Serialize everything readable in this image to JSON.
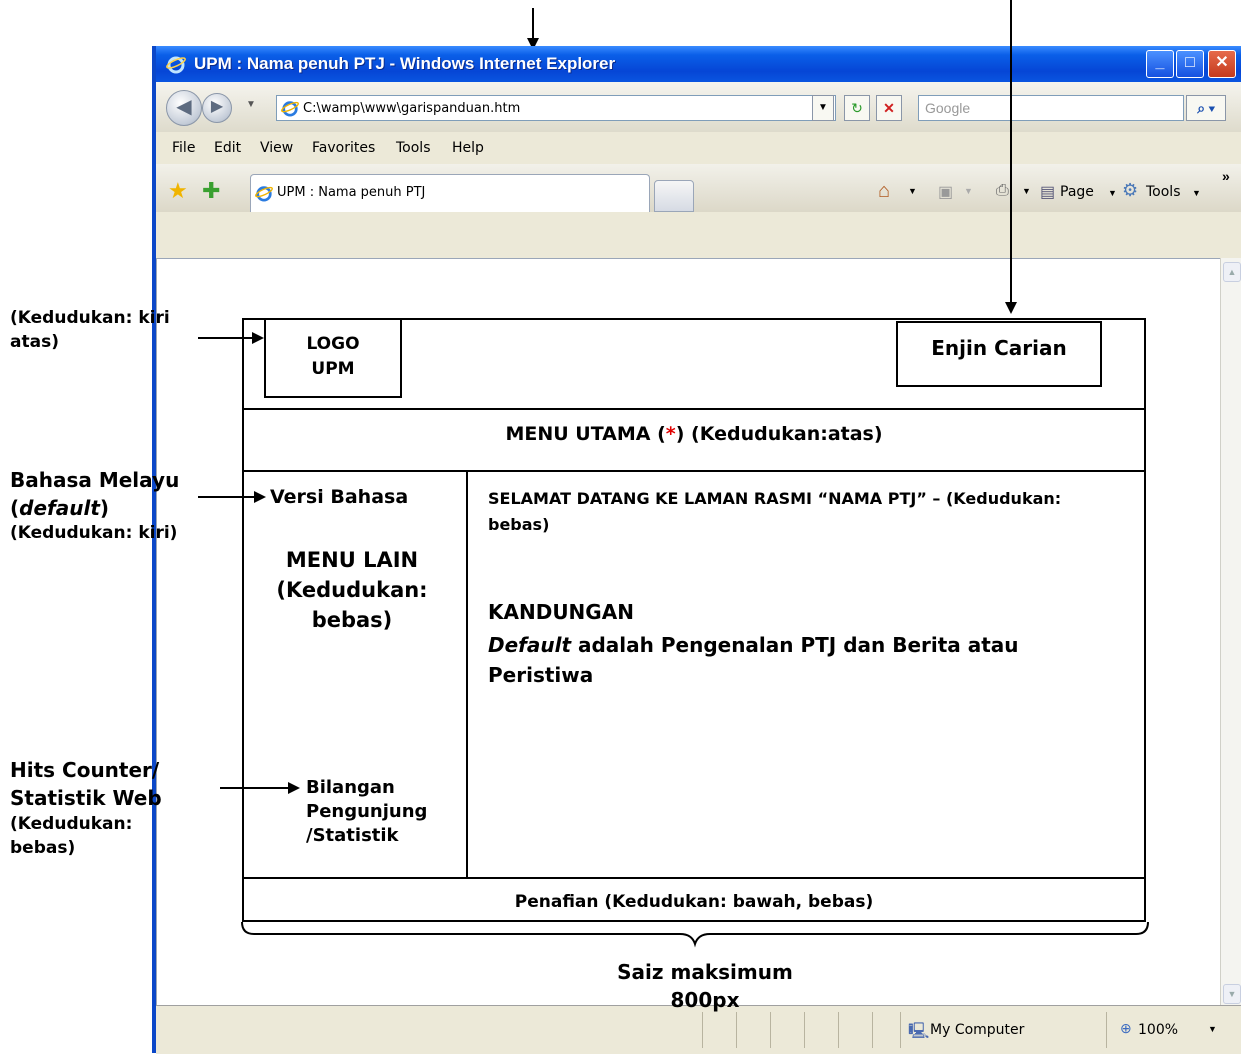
{
  "browser": {
    "title": "UPM : Nama penuh PTJ - Windows Internet Explorer",
    "address": "C:\\wamp\\www\\garispanduan.htm",
    "search_placeholder": "Google",
    "menu": [
      "File",
      "Edit",
      "View",
      "Favorites",
      "Tools",
      "Help"
    ],
    "tab_title": "UPM : Nama penuh PTJ",
    "toolbar": {
      "page_label": "Page",
      "tools_label": "Tools"
    },
    "status": {
      "zone": "My Computer",
      "zoom": "100%"
    }
  },
  "wireframe": {
    "logo": "LOGO UPM",
    "search_engine": "Enjin Carian",
    "main_menu_prefix": "MENU UTAMA (",
    "main_menu_star": "*",
    "main_menu_suffix": ") (Kedudukan:atas)",
    "language_version": "Versi Bahasa",
    "other_menu": "MENU LAIN (Kedudukan: bebas)",
    "welcome": "SELAMAT DATANG KE LAMAN RASMI “NAMA PTJ” – (Kedudukan: bebas)",
    "content_title": "KANDUNGAN",
    "content_default": "Default",
    "content_rest": " adalah Pengenalan PTJ dan Berita atau Peristiwa",
    "visitor_counter": "Bilangan Pengunjung /Statistik",
    "disclaimer": "Penafian (Kedudukan: bawah, bebas)",
    "max_size_line1": "Saiz maksimum",
    "max_size_line2": "800px"
  },
  "annotations": {
    "logo_position": "(Kedudukan: kiri atas)",
    "language_line1": "Bahasa Melayu",
    "language_default": "default",
    "language_line3": "(Kedudukan: kiri)",
    "hits_line1": "Hits Counter/",
    "hits_line2": "Statistik Web",
    "hits_line3": "(Kedudukan: bebas)"
  },
  "colors": {
    "titlebar": "#0a5fe8",
    "chrome": "#ece9d8",
    "star": "#e00000"
  }
}
